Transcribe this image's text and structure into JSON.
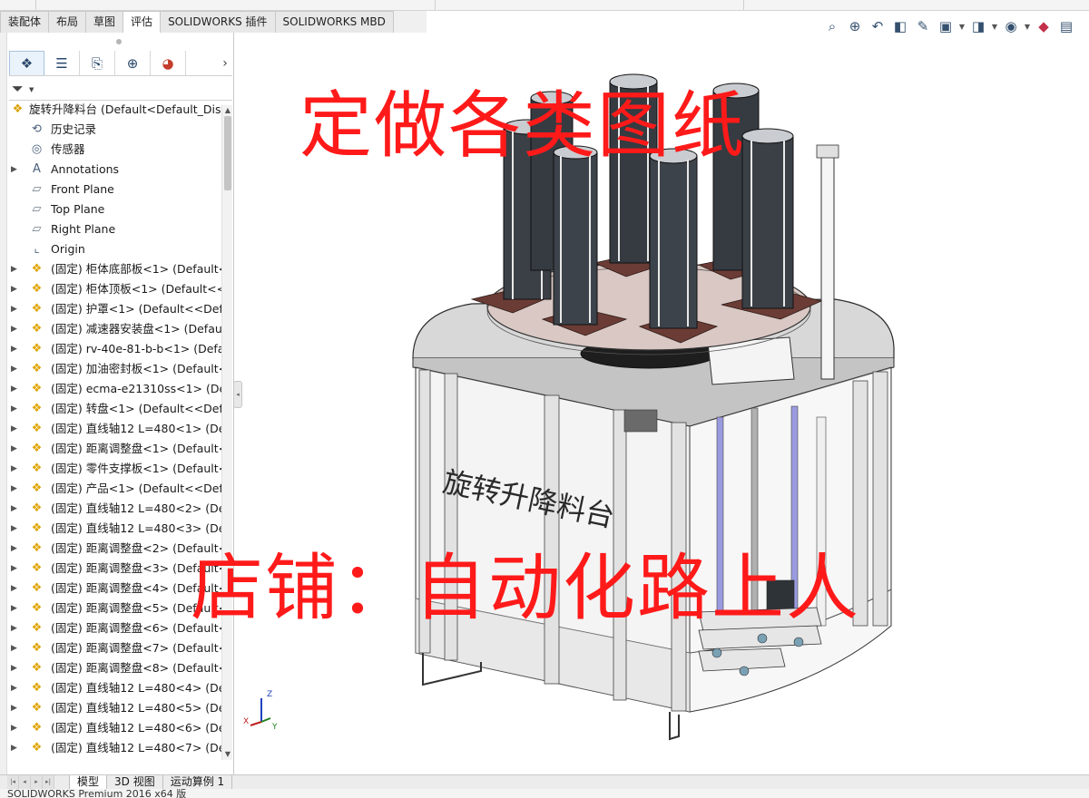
{
  "command_manager": {
    "tabs": [
      {
        "label": "装配体",
        "active": false
      },
      {
        "label": "布局",
        "active": false
      },
      {
        "label": "草图",
        "active": false
      },
      {
        "label": "评估",
        "active": true
      },
      {
        "label": "SOLIDWORKS 插件",
        "active": false
      },
      {
        "label": "SOLIDWORKS MBD",
        "active": false
      }
    ]
  },
  "heads_up_toolbar": {
    "icons": [
      "zoom-to-fit-icon",
      "zoom-to-area-icon",
      "previous-view-icon",
      "section-view-icon",
      "dynamic-annotation-icon",
      "view-orientation-icon",
      "display-style-icon",
      "hide-show-items-icon",
      "edit-appearance-icon",
      "apply-scene-icon"
    ]
  },
  "feature_manager": {
    "tabs": [
      "featuremanager-tree-icon",
      "propertymanager-icon",
      "configurationmanager-icon",
      "dimxpertmanager-icon",
      "displaymanager-icon"
    ],
    "root": {
      "label": "旋转升降料台  (Default<Default_Displ"
    },
    "items": [
      {
        "label": "历史记录",
        "icon": "history-icon",
        "expandable": false
      },
      {
        "label": "传感器",
        "icon": "sensor-icon",
        "expandable": false
      },
      {
        "label": "Annotations",
        "icon": "annotations-icon",
        "expandable": true
      },
      {
        "label": "Front Plane",
        "icon": "plane-icon",
        "expandable": false
      },
      {
        "label": "Top Plane",
        "icon": "plane-icon",
        "expandable": false
      },
      {
        "label": "Right Plane",
        "icon": "plane-icon",
        "expandable": false
      },
      {
        "label": "Origin",
        "icon": "origin-icon",
        "expandable": false
      },
      {
        "label": "(固定) 柜体底部板<1> (Default<<",
        "icon": "part-icon",
        "expandable": true
      },
      {
        "label": "(固定) 柜体顶板<1> (Default<<D",
        "icon": "part-icon",
        "expandable": true
      },
      {
        "label": "(固定) 护罩<1> (Default<<Defau",
        "icon": "part-icon",
        "expandable": true
      },
      {
        "label": "(固定) 减速器安装盘<1> (Default<",
        "icon": "part-icon",
        "expandable": true
      },
      {
        "label": "(固定) rv-40e-81-b-b<1> (Defau",
        "icon": "part-icon",
        "expandable": true
      },
      {
        "label": "(固定) 加油密封板<1> (Default<<",
        "icon": "part-icon",
        "expandable": true
      },
      {
        "label": "(固定) ecma-e21310ss<1> (Defa",
        "icon": "part-icon",
        "expandable": true
      },
      {
        "label": "(固定) 转盘<1> (Default<<Defau",
        "icon": "part-icon",
        "expandable": true
      },
      {
        "label": "(固定) 直线轴12  L=480<1> (Def",
        "icon": "part-icon",
        "expandable": true
      },
      {
        "label": "(固定) 距离调整盘<1> (Default<<",
        "icon": "part-icon",
        "expandable": true
      },
      {
        "label": "(固定) 零件支撑板<1> (Default<<",
        "icon": "part-icon",
        "expandable": true
      },
      {
        "label": "(固定) 产品<1> (Default<<Defau",
        "icon": "part-icon",
        "expandable": true
      },
      {
        "label": "(固定) 直线轴12  L=480<2> (Def",
        "icon": "part-icon",
        "expandable": true
      },
      {
        "label": "(固定) 直线轴12  L=480<3> (Def",
        "icon": "part-icon",
        "expandable": true
      },
      {
        "label": "(固定) 距离调整盘<2> (Default<<",
        "icon": "part-icon",
        "expandable": true
      },
      {
        "label": "(固定) 距离调整盘<3> (Default<<",
        "icon": "part-icon",
        "expandable": true
      },
      {
        "label": "(固定) 距离调整盘<4> (Default<<",
        "icon": "part-icon",
        "expandable": true
      },
      {
        "label": "(固定) 距离调整盘<5> (Default<<",
        "icon": "part-icon",
        "expandable": true
      },
      {
        "label": "(固定) 距离调整盘<6> (Default<<",
        "icon": "part-icon",
        "expandable": true
      },
      {
        "label": "(固定) 距离调整盘<7> (Default<<",
        "icon": "part-icon",
        "expandable": true
      },
      {
        "label": "(固定) 距离调整盘<8> (Default<<",
        "icon": "part-icon",
        "expandable": true
      },
      {
        "label": "(固定) 直线轴12  L=480<4> (Def",
        "icon": "part-icon",
        "expandable": true
      },
      {
        "label": "(固定) 直线轴12  L=480<5> (Def",
        "icon": "part-icon",
        "expandable": true
      },
      {
        "label": "(固定) 直线轴12  L=480<6> (Def",
        "icon": "part-icon",
        "expandable": true
      },
      {
        "label": "(固定) 直线轴12  L=480<7> (Def",
        "icon": "part-icon",
        "expandable": true
      }
    ]
  },
  "bottom_tabs": [
    {
      "label": "模型",
      "active": true
    },
    {
      "label": "3D 视图",
      "active": false
    },
    {
      "label": "运动算例 1",
      "active": false
    }
  ],
  "status": {
    "text": "SOLIDWORKS Premium 2016 x64 版"
  },
  "viewport": {
    "overlay_top": "定做各类图纸",
    "overlay_bottom": "店铺：自动化路上人",
    "engraving": "旋转升降料台",
    "triad": {
      "x": "X",
      "y": "Y",
      "z": "Z"
    }
  },
  "colors": {
    "overlay_red": "#ff1a1a",
    "fixture_brown": "#6b3c35",
    "stack_dark": "#2e3338",
    "frame_gray": "#d6d6d6",
    "rail_blue": "#8c8cd8"
  }
}
